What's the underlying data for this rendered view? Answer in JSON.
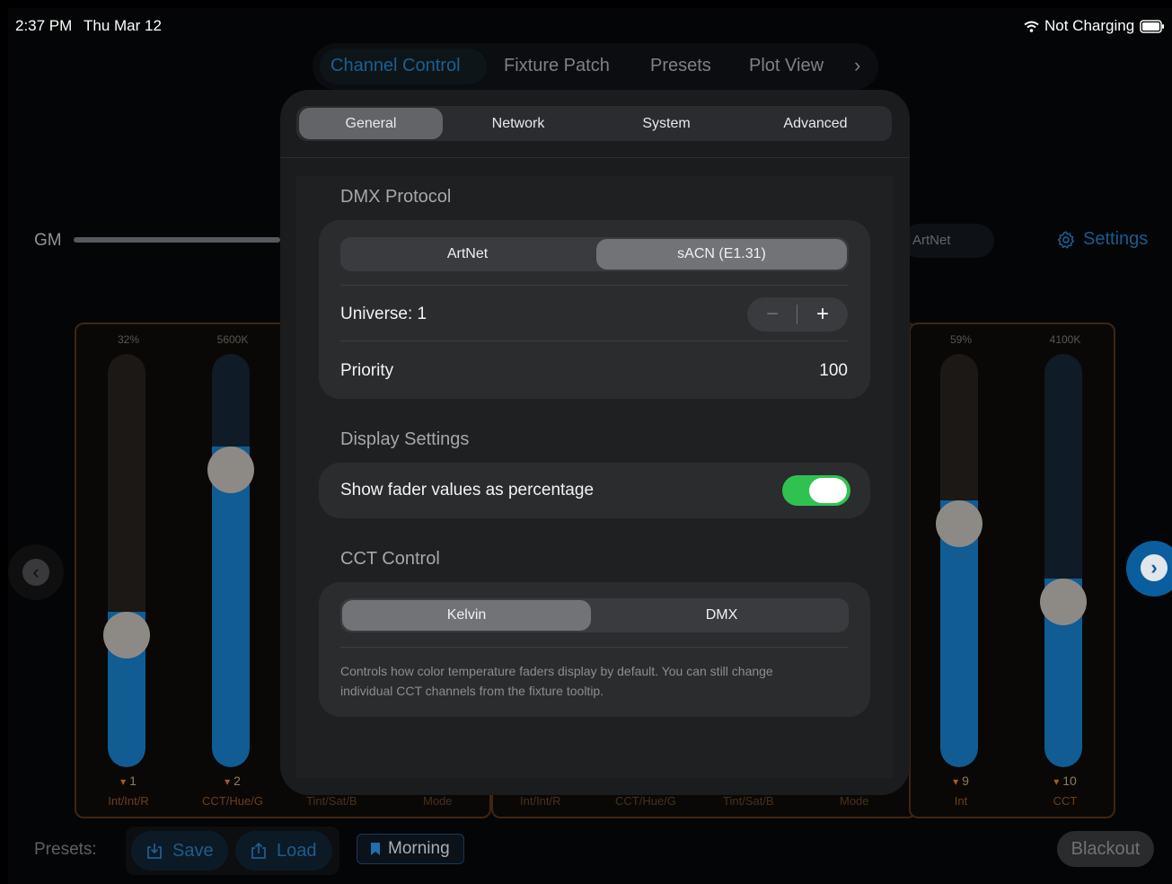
{
  "status_bar": {
    "time": "2:37 PM",
    "date": "Thu Mar 12",
    "battery_text": "Not Charging"
  },
  "top_tabs": {
    "items": [
      "Channel Control",
      "Fixture Patch",
      "Presets",
      "Plot View"
    ],
    "active": "Channel Control"
  },
  "gm": {
    "label": "GM"
  },
  "protocol_chip": "ArtNet",
  "settings": {
    "label": "Settings"
  },
  "fader_panels": [
    {
      "faders": [
        {
          "value": "32%",
          "level": 0.32,
          "number": "1",
          "label": "Int/Int/R"
        },
        {
          "value": "5600K",
          "level": 0.72,
          "number": "2",
          "label": "CCT/Hue/G"
        }
      ],
      "hidden_labels": [
        "Tint/Sat/B",
        "Mode"
      ]
    },
    {
      "hidden_labels": [
        "Int/Int/R",
        "CCT/Hue/G",
        "Tint/Sat/B",
        "Mode"
      ]
    },
    {
      "faders": [
        {
          "value": "59%",
          "level": 0.59,
          "number": "9",
          "label": "Int"
        },
        {
          "value": "4100K",
          "level": 0.4,
          "number": "10",
          "label": "CCT"
        }
      ]
    }
  ],
  "bottom_bar": {
    "presets_label": "Presets:",
    "save": "Save",
    "load": "Load",
    "active_preset": "Morning",
    "blackout": "Blackout"
  },
  "settings_modal": {
    "tabs": [
      "General",
      "Network",
      "System",
      "Advanced"
    ],
    "active_tab": "General",
    "dmx_protocol": {
      "title": "DMX Protocol",
      "options": [
        "ArtNet",
        "sACN (E1.31)"
      ],
      "selected": "sACN (E1.31)",
      "universe_label": "Universe: 1",
      "priority_label": "Priority",
      "priority_value": "100"
    },
    "display_settings": {
      "title": "Display Settings",
      "toggle_label": "Show fader values as percentage",
      "toggle_on": true
    },
    "cct_control": {
      "title": "CCT Control",
      "options": [
        "Kelvin",
        "DMX"
      ],
      "selected": "Kelvin",
      "help": "Controls how color temperature faders display by default. You can still change individual CCT channels from the fixture tooltip."
    }
  },
  "colors": {
    "accent_blue": "#105c93",
    "toggle_green": "#30c251",
    "panel_border": "#3e2612"
  }
}
